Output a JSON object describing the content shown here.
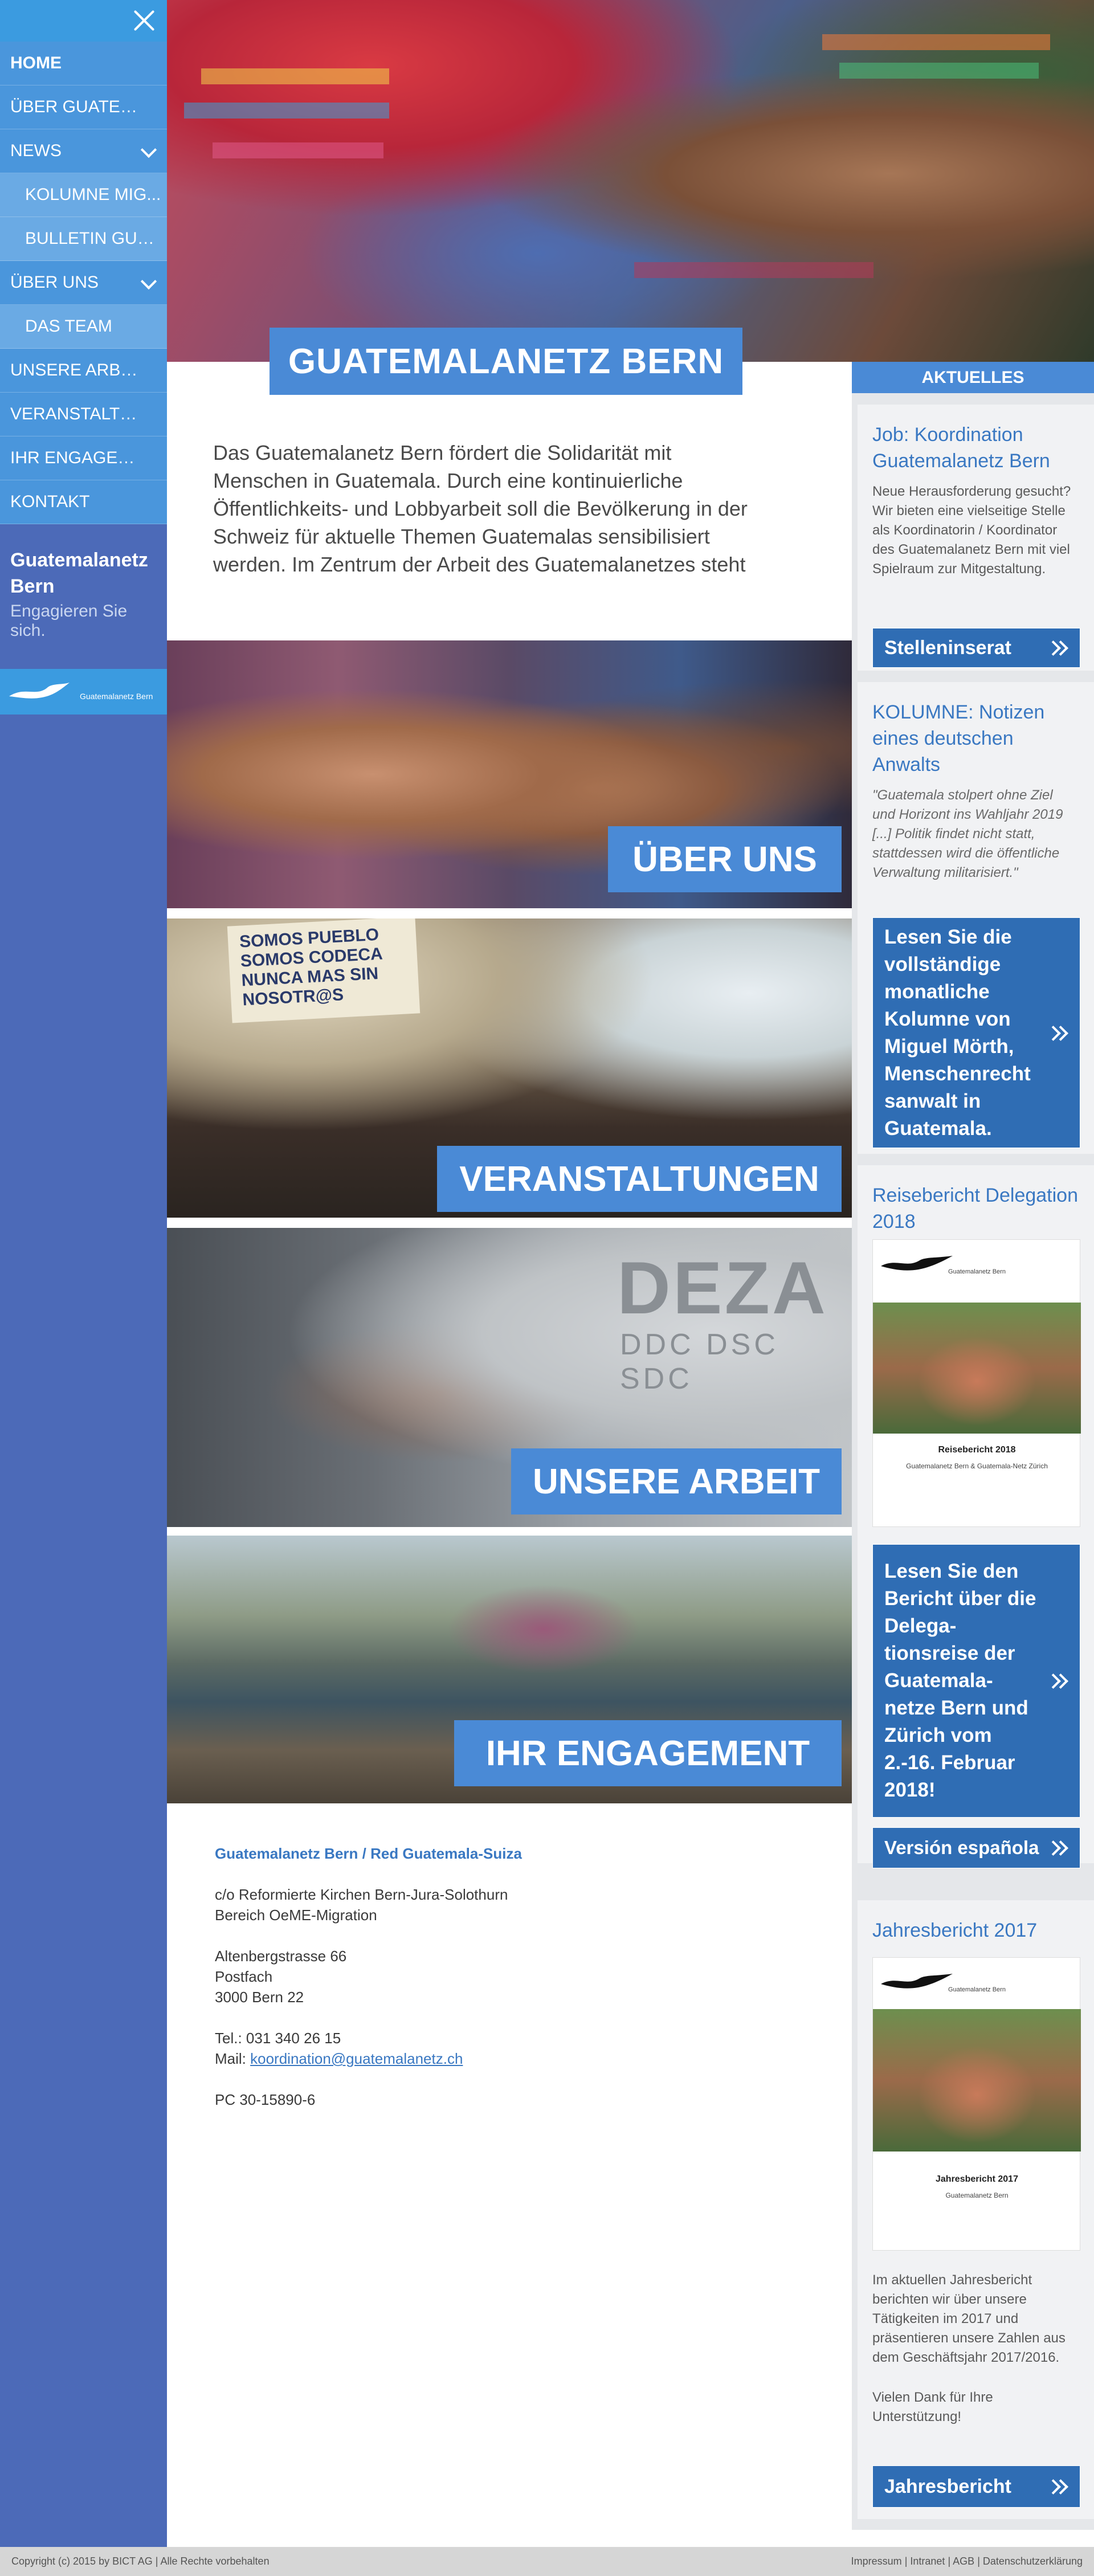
{
  "sidebar": {
    "nav": [
      {
        "label": "Home",
        "active": true
      },
      {
        "label": "Über Guatemala"
      },
      {
        "label": "News"
      },
      {
        "label": "Kolumne Mig..."
      },
      {
        "label": "Bulletin Guat..."
      },
      {
        "label": "Über uns"
      },
      {
        "label": "Das Team"
      },
      {
        "label": "Unsere Arbeit"
      },
      {
        "label": "Veranstaltungen"
      },
      {
        "label": "Ihr Engagement"
      },
      {
        "label": "Kontakt"
      }
    ],
    "brand_title": "Guatemalanetz Bern",
    "brand_subtitle": "Engagieren Sie sich.",
    "logo_text": "Guatemalanetz Bern"
  },
  "main": {
    "site_title": "GUATEMALANETZ BERN",
    "intro": "Das Guatemalanetz Bern fördert die Solidarität mit Menschen in Guatemala. Durch eine kontinuierliche Öffentlichkeits- und Lobbyarbeit soll die Bevölkerung in der Schweiz für aktuelle Themen Guatemalas sensibilisiert werden. Im Zentrum der Arbeit des Guatemalanetzes steht",
    "tiles": {
      "ueber_uns": "ÜBER UNS",
      "veranstaltungen": "VERANSTALTUNGEN",
      "unsere_arbeit": "UNSERE ARBEIT",
      "ihr_engagement": "IHR ENGAGEMENT"
    },
    "banner_text": "SOMOS PUEBLO SOMOS CODECA NUNCA MAS SIN NOSOTR@S",
    "deza": "DEZA",
    "deza_sub": "DDC DSC SDC",
    "address": {
      "org": "Guatemalanetz Bern / Red Guatemala-Suiza",
      "line1": "c/o Reformierte Kirchen Bern-Jura-Solothurn",
      "line2": "Bereich OeME-Migration",
      "street": "Altenbergstrasse 66",
      "box": "Postfach",
      "city": "3000 Bern 22",
      "tel": "Tel.: 031 340 26 15",
      "mail_label": "Mail: ",
      "mail": "koordination@guatemalanetz.ch",
      "pc": "PC 30-15890-6"
    }
  },
  "aside": {
    "header": "AKTUELLES",
    "job": {
      "title": "Job: Koordination Guatemalanetz Bern",
      "text": "Neue Herausforderung gesucht? Wir bieten eine vielseitige Stelle als Koordinatorin / Koordinator des Guatemalanetz Bern mit viel Spielraum zur Mitgestaltung.",
      "button": "Stelleninserat"
    },
    "kolumne": {
      "title": "KOLUMNE: Notizen eines deutschen Anwalts",
      "quote": "\"Guatemala stolpert ohne Ziel und Horizont ins Wahljahr 2019 [...] Politik findet nicht statt, stattdessen wird die öffentliche Verwaltung militarisiert.\"",
      "button": "Lesen Sie die vollständige monatliche Kolumne von Miguel Mörth, Menschenrecht sanwalt in Guatemala."
    },
    "reise": {
      "title": "Reisebericht Delegation 2018",
      "thumb_logo": "Guatemalanetz Bern",
      "thumb_caption": "Reisebericht 2018",
      "thumb_sub": "Guatemalanetz Bern & Guatemala-Netz Zürich",
      "button": "Lesen Sie den Bericht über die Delega-tionsreise der Guatemala-netze Bern und Zürich vom 2.-16. Februar 2018!",
      "button2": "Versión española"
    },
    "jahres": {
      "title": "Jahresbericht 2017",
      "thumb_logo": "Guatemalanetz Bern",
      "thumb_caption": "Jahresbericht 2017",
      "thumb_sub": "Guatemalanetz Bern",
      "text": "Im aktuellen Jahresbericht berichten wir über unsere Tätigkeiten im 2017 und präsentieren unsere Zahlen aus dem Geschäftsjahr 2017/2016.",
      "thanks": "Vielen Dank für Ihre Unterstützung!",
      "button": "Jahresbericht"
    }
  },
  "footer": {
    "copyright": "Copyright (c) 2015 by BICT AG | Alle Rechte vorbehalten",
    "impressum": "Impressum",
    "intranet": "Intranet",
    "agb": "AGB",
    "datenschutz": "Datenschutzerklärung",
    "sep": "|"
  },
  "colors": {
    "accent": "#4a8ad6",
    "sidebar": "#4c6ab8",
    "nav": "#4a96dc",
    "button": "#2f6db4"
  }
}
